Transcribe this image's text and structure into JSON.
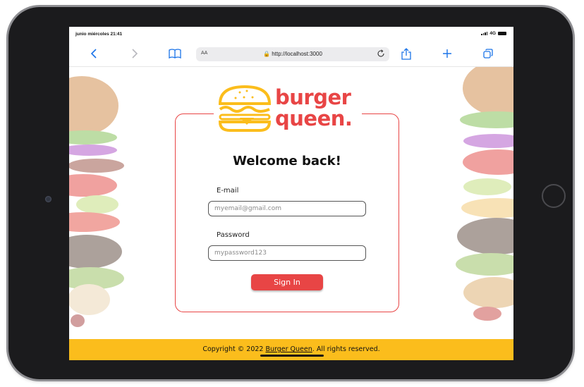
{
  "status_bar": {
    "time": "junio miércoles 21:41",
    "network": "4G"
  },
  "browser": {
    "text_size_label": "AA",
    "url": "http://localhost:3000"
  },
  "logo": {
    "line1": "burger",
    "line2": "queen."
  },
  "login": {
    "heading": "Welcome back!",
    "email_label": "E-mail",
    "email_placeholder": "myemail@gmail.com",
    "password_label": "Password",
    "password_placeholder": "mypassword123",
    "submit_label": "Sign In"
  },
  "footer": {
    "prefix": "Copyright © 2022 ",
    "brand": "Burger Queen",
    "suffix": ". All rights reserved."
  },
  "colors": {
    "accent": "#e84545",
    "footer_bg": "#fbbd1c",
    "logo_yellow": "#fbbd1c",
    "link_blue": "#1a73e8"
  }
}
